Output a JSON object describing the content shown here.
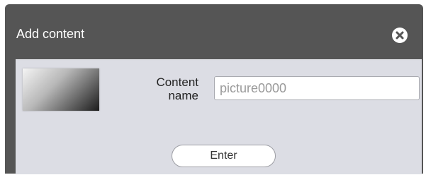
{
  "dialog": {
    "title": "Add content",
    "close_icon": "close-circle-icon"
  },
  "form": {
    "label_line1": "Content",
    "label_line2": "name",
    "content_name_value": "picture0000",
    "preview_icon": "image-thumbnail"
  },
  "actions": {
    "enter_label": "Enter"
  },
  "colors": {
    "title_bar": "#555555",
    "panel": "#dcdde4"
  }
}
